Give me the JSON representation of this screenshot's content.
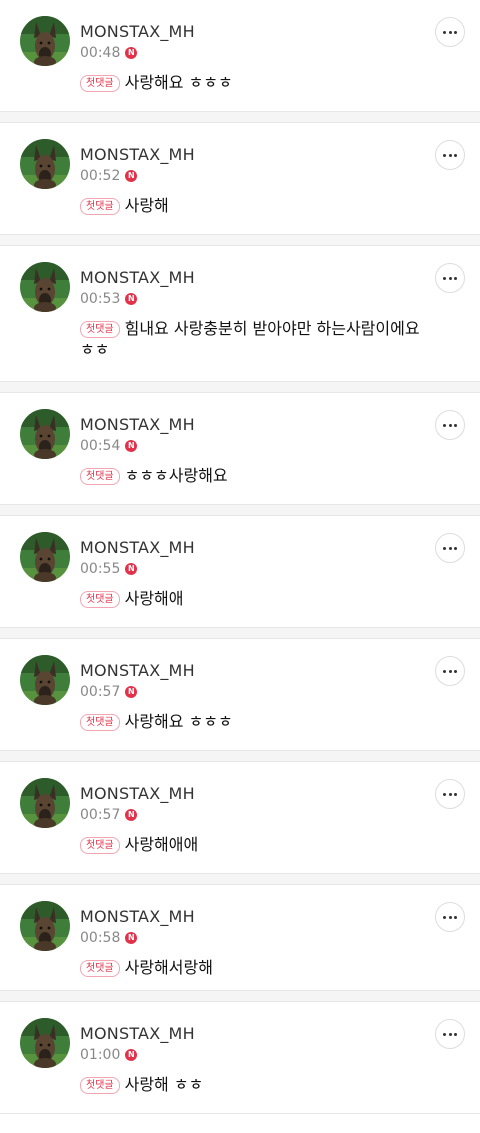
{
  "comments": [
    {
      "username": "MONSTAX_MH",
      "time": "00:48",
      "new_badge": "N",
      "first_badge": "첫댓글",
      "text": "사랑해요 ㅎㅎㅎ",
      "avatar": "dog-avatar"
    },
    {
      "username": "MONSTAX_MH",
      "time": "00:52",
      "new_badge": "N",
      "first_badge": "첫댓글",
      "text": "사랑해",
      "avatar": "dog-avatar"
    },
    {
      "username": "MONSTAX_MH",
      "time": "00:53",
      "new_badge": "N",
      "first_badge": "첫댓글",
      "text": "힘내요 사랑충분히 받아야만 하는사람이에요 ㅎㅎ",
      "avatar": "dog-avatar"
    },
    {
      "username": "MONSTAX_MH",
      "time": "00:54",
      "new_badge": "N",
      "first_badge": "첫댓글",
      "text": "ㅎㅎㅎ사랑해요",
      "avatar": "dog-avatar"
    },
    {
      "username": "MONSTAX_MH",
      "time": "00:55",
      "new_badge": "N",
      "first_badge": "첫댓글",
      "text": "사랑해애",
      "avatar": "dog-avatar"
    },
    {
      "username": "MONSTAX_MH",
      "time": "00:57",
      "new_badge": "N",
      "first_badge": "첫댓글",
      "text": "사랑해요 ㅎㅎㅎ",
      "avatar": "dog-avatar"
    },
    {
      "username": "MONSTAX_MH",
      "time": "00:57",
      "new_badge": "N",
      "first_badge": "첫댓글",
      "text": "사랑해애애",
      "avatar": "dog-avatar"
    },
    {
      "username": "MONSTAX_MH",
      "time": "00:58",
      "new_badge": "N",
      "first_badge": "첫댓글",
      "text": "사랑해서랑해",
      "avatar": "dog-avatar"
    },
    {
      "username": "MONSTAX_MH",
      "time": "01:00",
      "new_badge": "N",
      "first_badge": "첫댓글",
      "text": "사랑해 ㅎㅎ",
      "avatar": "dog-avatar"
    }
  ],
  "icons": {
    "more": "more-horizontal-icon",
    "new": "new-badge"
  },
  "colors": {
    "accent": "#e3314a",
    "badge_border": "#f2a6b2",
    "divider": "#e6e6e6",
    "gap": "#f5f5f5",
    "meta_text": "#888888"
  }
}
